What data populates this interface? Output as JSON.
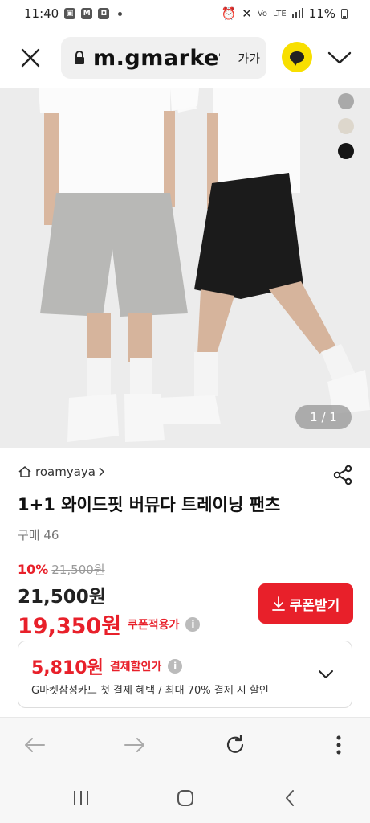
{
  "status_bar": {
    "time": "11:40",
    "network": "LTE",
    "signal_prefix": "Vo",
    "battery": "11%"
  },
  "browser": {
    "url": "m.gmarket.co.kr",
    "text_size_label": "가가"
  },
  "product_image": {
    "counter": "1 / 1",
    "swatches": [
      "#a9a9a9",
      "#ddd7cc",
      "#151515"
    ]
  },
  "product": {
    "seller": "roamyaya",
    "title": "1+1 와이드핏 버뮤다 트레이닝 팬츠",
    "purchase_count": "구매 46",
    "discount_rate": "10%",
    "original_price": "21,500원",
    "sale_price": "21,500원",
    "coupon_price": "19,350원",
    "coupon_label": "쿠폰적용가",
    "coupon_button": "쿠폰받기"
  },
  "card_discount": {
    "price": "5,810원",
    "label": "결제할인가",
    "description": "G마켓삼성카드 첫 결제 혜택 / 최대 70% 결제 시 할인"
  },
  "colors": {
    "accent_red": "#e8202a",
    "kakao_yellow": "#f8df00"
  }
}
